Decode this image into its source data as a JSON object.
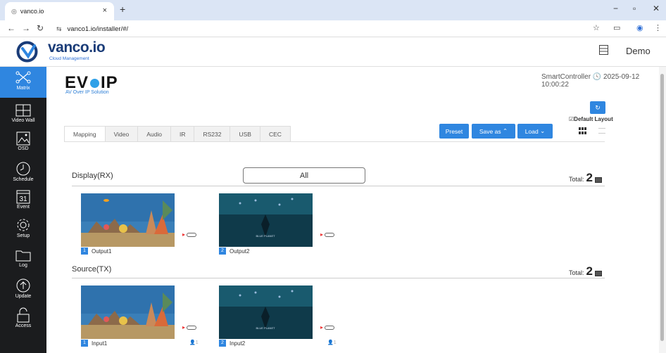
{
  "browser": {
    "tab_title": "vanco.io",
    "url": "vanco1.io/installer/#/",
    "close_symbol": "×",
    "new_tab_symbol": "+",
    "favicon_symbol": "◎",
    "tune_symbol": "⇆"
  },
  "header": {
    "brand": "vanco.io",
    "brand_sub": "Cloud Management",
    "user": "Demo"
  },
  "sidebar": {
    "items": [
      {
        "label": "Matrix",
        "icon": "matrix-icon",
        "active": true
      },
      {
        "label": "Video Wall",
        "icon": "video-wall-icon"
      },
      {
        "label": "OSD",
        "icon": "osd-icon"
      },
      {
        "label": "Schedule",
        "icon": "clock-icon"
      },
      {
        "label": "Event",
        "icon": "calendar-icon",
        "glyph": "31"
      },
      {
        "label": "Setup",
        "icon": "gear-icon"
      },
      {
        "label": "Log",
        "icon": "folder-icon"
      },
      {
        "label": "Update",
        "icon": "upload-icon"
      },
      {
        "label": "Access",
        "icon": "lock-icon"
      }
    ]
  },
  "product": {
    "logo_left": "EV",
    "logo_right": "IP",
    "subtitle": "AV Over IP Solution"
  },
  "status": {
    "controller": "SmartController",
    "datetime": "2025-09-12 10:00:22"
  },
  "toolbar": {
    "refresh_symbol": "↻",
    "default_layout": "Default Layout",
    "default_layout_checked": true,
    "preset": "Preset",
    "save_as": "Save as",
    "load": "Load"
  },
  "tabs": [
    "Mapping",
    "Video",
    "Audio",
    "IR",
    "RS232",
    "USB",
    "CEC"
  ],
  "display": {
    "title": "Display(RX)",
    "filter": "All",
    "total_label": "Total:",
    "total": "2",
    "items": [
      {
        "num": "1",
        "name": "Output1",
        "scene": "aquarium"
      },
      {
        "num": "2",
        "name": "Output2",
        "scene": "diver"
      }
    ]
  },
  "source": {
    "title": "Source(TX)",
    "total_label": "Total:",
    "total": "2",
    "items": [
      {
        "num": "1",
        "name": "Input1",
        "users": "1",
        "scene": "aquarium"
      },
      {
        "num": "2",
        "name": "Input2",
        "users": "1",
        "scene": "diver"
      }
    ]
  },
  "overlay": {
    "channel": "BLUE PLANET"
  },
  "colors": {
    "accent": "#2f86e0",
    "sidebar": "#1b1c1e",
    "brand": "#1a3c78",
    "link": "#e33333"
  }
}
